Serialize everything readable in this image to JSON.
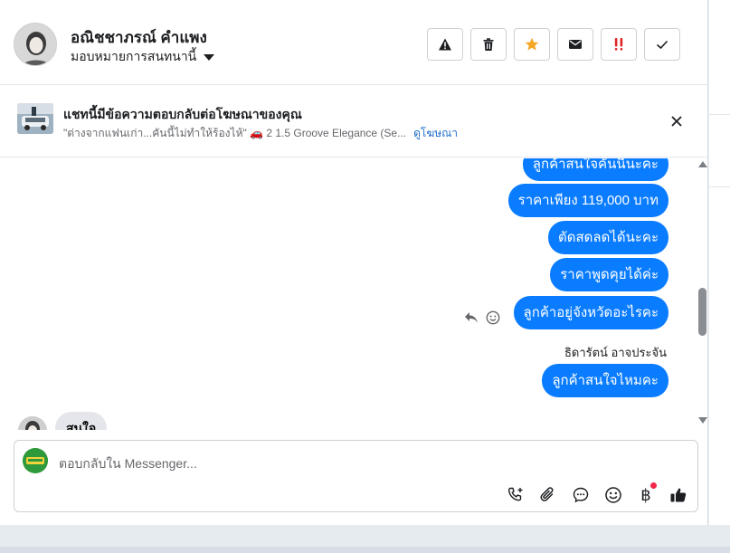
{
  "header": {
    "name": "อณิชชาภรณ์ คำแพง",
    "assign_label": "มอบหมายการสนทนานี้",
    "actions": [
      {
        "icon": "warning-icon"
      },
      {
        "icon": "trash-icon"
      },
      {
        "icon": "star-icon",
        "color": "#f5a623"
      },
      {
        "icon": "envelope-icon"
      },
      {
        "icon": "urgent-icon",
        "color": "#e02424"
      },
      {
        "icon": "check-icon"
      }
    ]
  },
  "ad": {
    "title": "แชทนี้มีข้อความตอบกลับต่อโฆษณาของคุณ",
    "subtitle": "\"ต่างจากแฟนเก่า...คันนี้ไม่ทำให้ร้องไห้\" 🚗 2 1.5 Groove Elegance (Se...",
    "link": "ดูโฆษณา"
  },
  "messages": {
    "outgoing": [
      "ลูกค้าสนใจคันนี้นะคะ",
      "ราคาเพียง 119,000 บาท",
      "ตัดสดลดได้นะคะ",
      "ราคาพูดคุยได้ค่ะ",
      "ลูกค้าอยู่จังหวัดอะไรคะ",
      "ลูกค้าสนใจไหมคะ"
    ],
    "sender_name": "ธิดารัตน์ อาจประจัน",
    "incoming": "สนใจ"
  },
  "composer": {
    "placeholder": "ตอบกลับใน Messenger..."
  },
  "colors": {
    "bubble": "#0a7cff",
    "link": "#1d6ecb"
  }
}
